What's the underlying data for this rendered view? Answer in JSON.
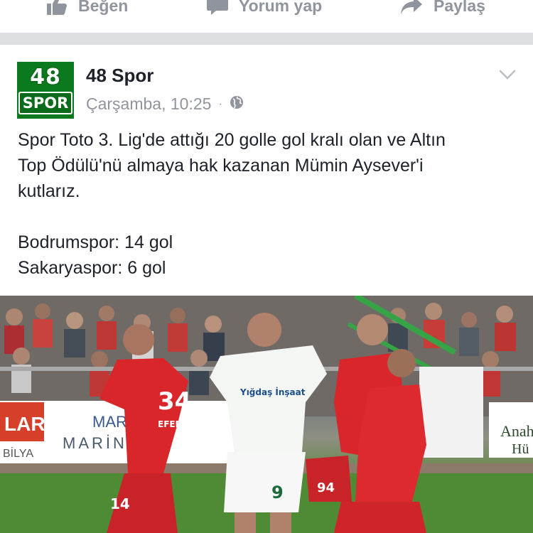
{
  "actions": {
    "like": "Beğen",
    "comment": "Yorum yap",
    "share": "Paylaş"
  },
  "post": {
    "avatar": {
      "top": "48",
      "bottom": "SPOR"
    },
    "page_name": "48 Spor",
    "timestamp": "Çarşamba, 10:25",
    "separator": "·",
    "audience_icon": "globe-icon",
    "text_lines": [
      "Spor Toto 3. Lig'de attığı 20 golle gol kralı olan ve Altın",
      "Top Ödülü'nü almaya hak kazanan Mümin Aysever'i",
      "kutlarız."
    ],
    "stats": [
      "Bodrumspor: 14 gol",
      "Sakaryaspor: 6 gol"
    ],
    "photo": {
      "banner_left_1": "LAR",
      "banner_left_2": "BİLYA",
      "banner_marina_1": "MARİ",
      "banner_marina_2": "MARİNA",
      "banner_right": "Anah",
      "banner_right_2": "Hü",
      "player1_number": "34",
      "player1_name": "EFEBERK",
      "player2_number": "9",
      "player2_sponsor": "Yığdaş İnşaat",
      "player3_number": "94",
      "player4_number": "14"
    }
  },
  "colors": {
    "text_primary": "#1d2129",
    "text_secondary": "#90949c",
    "divider": "#dddfe2",
    "avatar_green": "#0b7a1e",
    "jersey_red": "#d9262b"
  }
}
